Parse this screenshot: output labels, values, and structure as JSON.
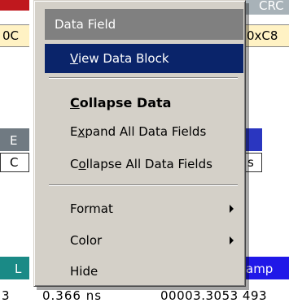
{
  "background": {
    "top_right_label": "CRC",
    "left_row1": "0C",
    "right_row1": "0xC8",
    "left_header": "E",
    "left_cell": "C",
    "right_cell": "s",
    "bottom_left_header": "L",
    "bottom_right_header": "amp",
    "bottom_left_value": "3",
    "bottom_mid_value": "0.366 ns",
    "bottom_right_value": "00003.3053 493"
  },
  "menu": {
    "header": "Data Field",
    "items": [
      {
        "pre": "",
        "accel": "V",
        "post": "iew Data Block",
        "selected": true,
        "bold": false,
        "submenu": false
      },
      {
        "pre": "",
        "accel": "C",
        "post": "ollapse Data",
        "selected": false,
        "bold": true,
        "submenu": false
      },
      {
        "pre": "E",
        "accel": "x",
        "post": "pand All Data Fields",
        "selected": false,
        "bold": false,
        "submenu": false
      },
      {
        "pre": "C",
        "accel": "o",
        "post": "llapse All Data Fields",
        "selected": false,
        "bold": false,
        "submenu": false
      },
      {
        "pre": "",
        "accel": "",
        "post": "Format",
        "selected": false,
        "bold": false,
        "submenu": true
      },
      {
        "pre": "",
        "accel": "",
        "post": "Color",
        "selected": false,
        "bold": false,
        "submenu": true
      },
      {
        "pre": "",
        "accel": "",
        "post": "Hide",
        "selected": false,
        "bold": false,
        "submenu": false
      }
    ]
  },
  "colors": {
    "menu_bg": "#d4d0c8",
    "selection": "#0a246a",
    "header_bg": "#808080"
  }
}
